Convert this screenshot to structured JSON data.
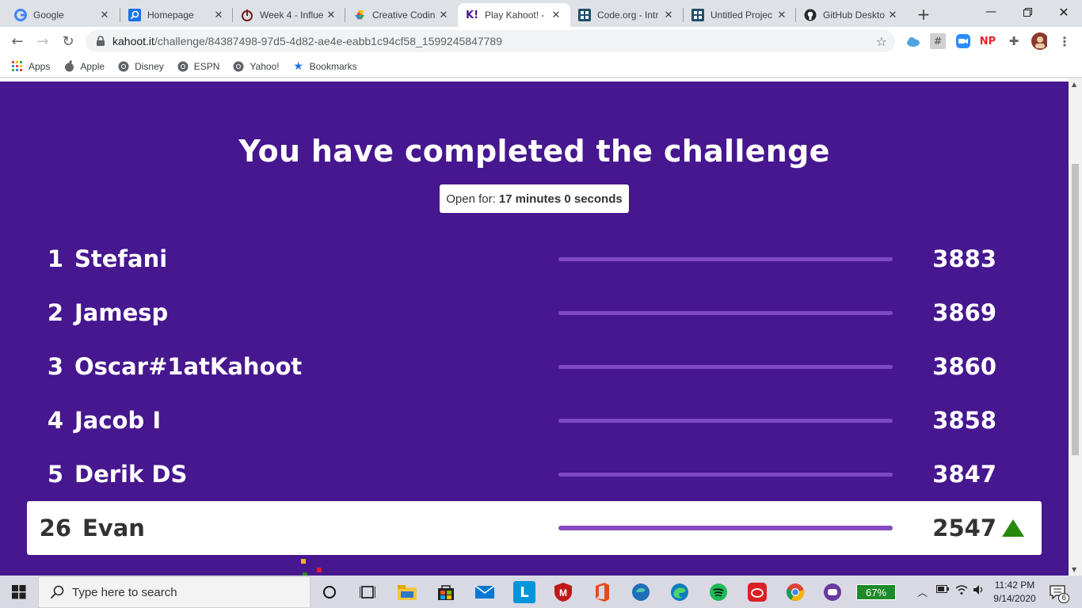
{
  "browser": {
    "tabs": [
      {
        "title": "Google",
        "icon": "google-icon",
        "active": false
      },
      {
        "title": "Homepage",
        "icon": "search-blue-icon",
        "active": false
      },
      {
        "title": "Week 4 - Influe",
        "icon": "power-icon",
        "active": false
      },
      {
        "title": "Creative Codin",
        "icon": "diamond-icon",
        "active": false
      },
      {
        "title": "Play Kahoot! -",
        "icon": "kahoot-icon",
        "active": true
      },
      {
        "title": "Code.org - Intr",
        "icon": "codeorg-icon",
        "active": false
      },
      {
        "title": "Untitled Projec",
        "icon": "codeorg-icon",
        "active": false
      },
      {
        "title": "GitHub Deskto",
        "icon": "github-icon",
        "active": false
      }
    ],
    "url_host": "kahoot.it",
    "url_path": "/challenge/84387498-97d5-4d82-ae4e-eabb1c94cf58_1599245847789",
    "extensions": [
      "NP"
    ],
    "bookmarks": [
      {
        "label": "Apps",
        "icon": "apps-grid-icon"
      },
      {
        "label": "Apple",
        "icon": "apple-icon"
      },
      {
        "label": "Disney",
        "icon": "globe-icon"
      },
      {
        "label": "ESPN",
        "icon": "globe-icon"
      },
      {
        "label": "Yahoo!",
        "icon": "globe-icon"
      },
      {
        "label": "Bookmarks",
        "icon": "star-icon"
      }
    ]
  },
  "page": {
    "headline": "You have completed the challenge",
    "open_for_label": "Open for:",
    "open_for_value": "17 minutes 0 seconds",
    "leaderboard": [
      {
        "rank": "1",
        "name": "Stefani",
        "score": "3883"
      },
      {
        "rank": "2",
        "name": "Jamesp",
        "score": "3869"
      },
      {
        "rank": "3",
        "name": "Oscar#1atKahoot",
        "score": "3860"
      },
      {
        "rank": "4",
        "name": "Jacob I",
        "score": "3858"
      },
      {
        "rank": "5",
        "name": "Derik DS",
        "score": "3847"
      }
    ],
    "me": {
      "rank": "26",
      "name": "Evan",
      "score": "2547",
      "trend": "up-arrow-icon"
    },
    "colors": {
      "background": "#46178f",
      "bar": "#7e4ac4",
      "trend_up": "#26890c"
    }
  },
  "taskbar": {
    "search_placeholder": "Type here to search",
    "battery": "67%",
    "time": "11:42 PM",
    "date": "9/14/2020",
    "notification_count": "6"
  }
}
